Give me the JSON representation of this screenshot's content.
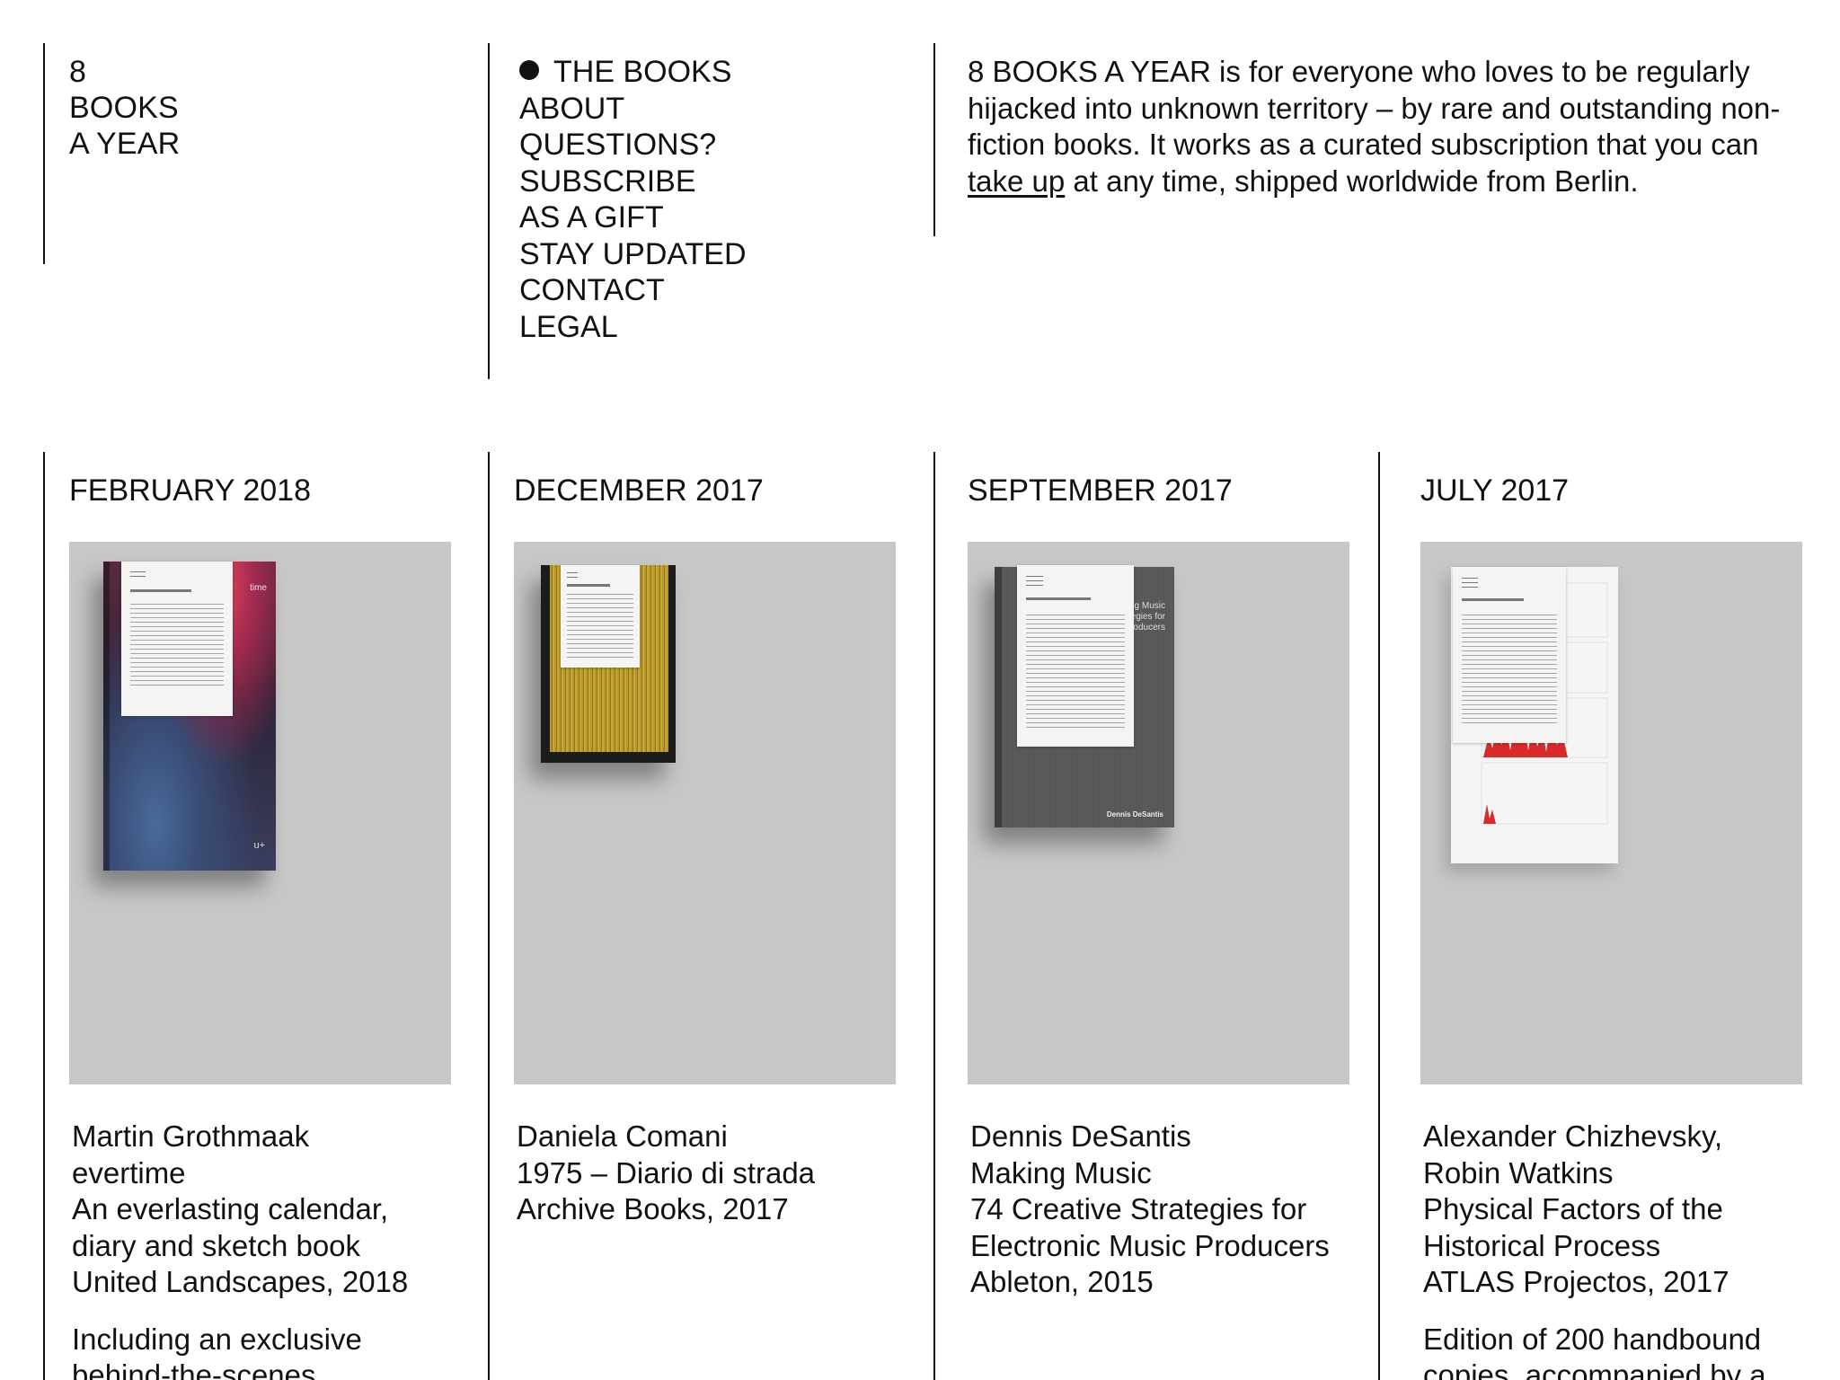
{
  "logo": {
    "line1": "8",
    "line2": "BOOKS",
    "line3": "A YEAR"
  },
  "nav": {
    "items": [
      {
        "label": "THE BOOKS",
        "active": true
      },
      {
        "label": "ABOUT",
        "active": false
      },
      {
        "label": "QUESTIONS?",
        "active": false
      },
      {
        "label": "SUBSCRIBE",
        "active": false
      },
      {
        "label": "AS A GIFT",
        "active": false
      },
      {
        "label": "STAY UPDATED",
        "active": false
      },
      {
        "label": "CONTACT",
        "active": false
      },
      {
        "label": "LEGAL",
        "active": false
      }
    ]
  },
  "intro": {
    "text_before_link": "8 BOOKS A YEAR is for everyone who loves to be regularly hijacked into unknown territory – by rare and outstanding non-fiction books. It works as a curated subscription that you can ",
    "link_text": "take up",
    "text_after_link": " at any time, shipped worldwide from Berlin."
  },
  "books": [
    {
      "month": "FEBRUARY 2018",
      "lines": [
        "Martin Grothmaak",
        "evertime",
        "An everlasting calendar,",
        "diary and sketch book",
        "United Landscapes, 2018"
      ],
      "extra": [
        "Including an exclusive",
        "behind-the-scenes"
      ],
      "cover_title": "time",
      "cover_mark": "u+"
    },
    {
      "month": "DECEMBER 2017",
      "lines": [
        "Daniela Comani",
        "1975 – Diario di strada",
        "Archive Books, 2017"
      ],
      "extra": []
    },
    {
      "month": "SEPTEMBER 2017",
      "lines": [
        "Dennis DeSantis",
        "Making Music",
        "74 Creative Strategies for",
        "Electronic Music Producers",
        "Ableton, 2015"
      ],
      "extra": [],
      "cover_title_1": "ing Music",
      "cover_title_2": "ategies for",
      "cover_title_3": "Producers",
      "cover_author": "Dennis DeSantis"
    },
    {
      "month": "JULY 2017",
      "lines": [
        "Alexander Chizhevsky,",
        "Robin Watkins",
        "Physical Factors of the",
        "Historical Process",
        "ATLAS Projectos, 2017"
      ],
      "extra": [
        "Edition of 200 handbound",
        "copies, accompanied by a"
      ]
    }
  ],
  "colors": {
    "text": "#111111",
    "cover_background": "#c7c7c7",
    "background": "#ffffff"
  }
}
